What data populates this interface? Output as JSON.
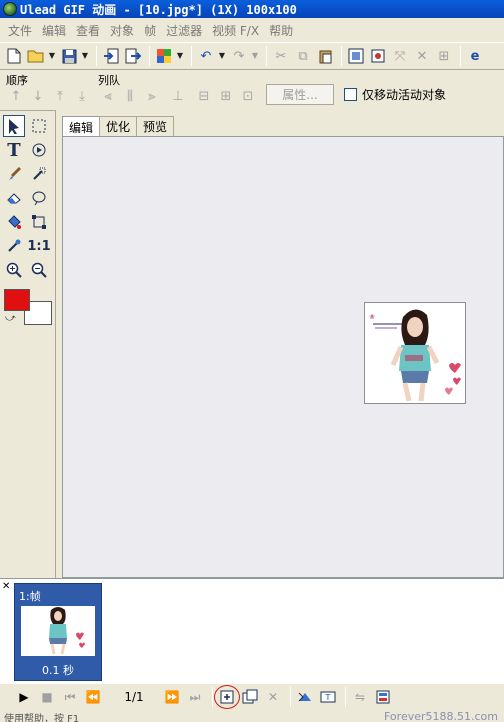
{
  "title_bar": {
    "title": "Ulead GIF 动画 - [10.jpg*] (1X) 100x100"
  },
  "menu": {
    "items": [
      "文件",
      "编辑",
      "查看",
      "对象",
      "帧",
      "过滤器",
      "视频 F/X",
      "帮助"
    ]
  },
  "toolbar": {
    "icons": [
      "new-file-icon",
      "open-folder-icon",
      "save-icon",
      "import-icon",
      "export-icon",
      "color-palette-icon",
      "undo-icon",
      "redo-icon",
      "cut-icon",
      "copy-icon",
      "paste-icon",
      "crop-icon",
      "rotate-icon",
      "resize-icon",
      "optimize-icon",
      "browser-icon"
    ]
  },
  "toolbar2": {
    "order_label": "顺序",
    "queue_label": "列队",
    "attributes_button": "属性...",
    "move_active_label": "仅移动活动对象"
  },
  "tools": {
    "items": [
      "pointer",
      "marquee",
      "text",
      "lasso",
      "brush",
      "magic-wand",
      "eraser",
      "ellipse",
      "paint-bucket",
      "transform",
      "eyedropper",
      "one-to-one",
      "zoom-in",
      "zoom-out"
    ],
    "foreground_color": "#e01010",
    "background_color": "#ffffff",
    "one_to_one_label": "1:1"
  },
  "tabs": {
    "items": [
      "编辑",
      "优化",
      "预览"
    ],
    "active": "编辑"
  },
  "frames": {
    "items": [
      {
        "label": "1:帧",
        "delay": "0.1 秒"
      }
    ]
  },
  "playback": {
    "frame_counter": "1/1"
  },
  "status": {
    "text": "使用帮助，按 F1",
    "watermark": "Forever5188.51.com"
  }
}
